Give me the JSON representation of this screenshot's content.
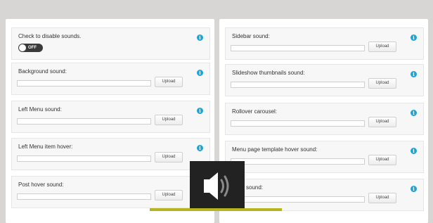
{
  "left_panel": {
    "toggle_item": {
      "label": "Check to disable sounds.",
      "toggle_text": "OFF"
    },
    "items": [
      {
        "label": "Background sound:",
        "button": "Upload"
      },
      {
        "label": "Left Menu sound:",
        "button": "Upload"
      },
      {
        "label": "Left Menu item hover:",
        "button": "Upload"
      },
      {
        "label": "Post hover sound:",
        "button": "Upload"
      }
    ]
  },
  "right_panel": {
    "items": [
      {
        "label": "Sidebar sound:",
        "button": "Upload"
      },
      {
        "label": "Slideshow thumbnails sound:",
        "button": "Upload"
      },
      {
        "label": "Rollover carousel:",
        "button": "Upload"
      },
      {
        "label": "Menu page template hover sound:",
        "button": "Upload"
      },
      {
        "label": "ment sound:",
        "button": "Upload"
      }
    ]
  },
  "overlay": {
    "icon": "speaker-volume-icon"
  },
  "colors": {
    "info": "#1aa5d9",
    "accent_bar": "#b5b520",
    "overlay_bg": "#222222"
  }
}
